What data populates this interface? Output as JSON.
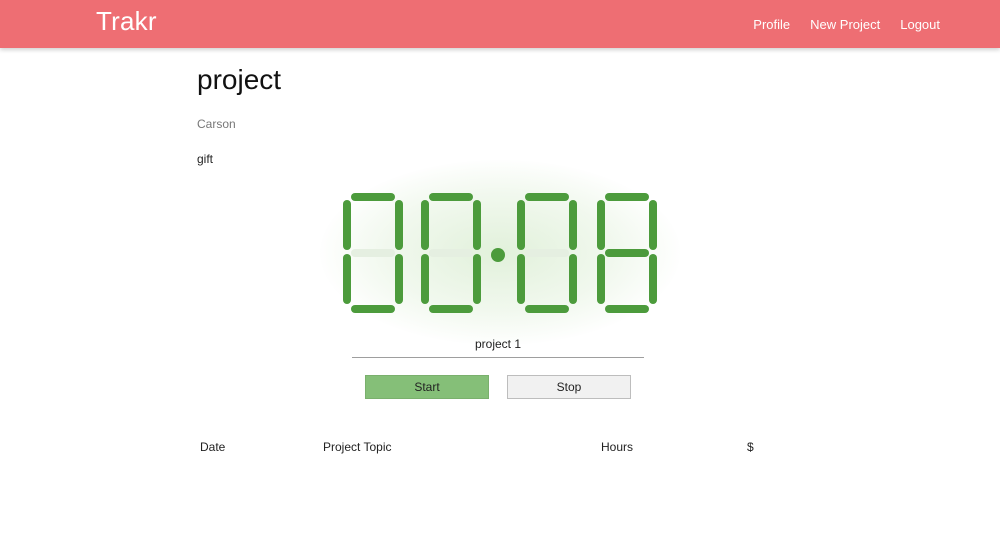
{
  "navbar": {
    "brand": "Trakr",
    "links": [
      "Profile",
      "New Project",
      "Logout"
    ]
  },
  "project": {
    "title": "project",
    "owner": "Carson",
    "description": "gift"
  },
  "timer": {
    "display": "00:08",
    "project_label": "project 1",
    "segment_on_color": "#4c9b3c",
    "segment_off_color": "#e5efe1"
  },
  "buttons": {
    "start": "Start",
    "stop": "Stop"
  },
  "table": {
    "headers": [
      "Date",
      "Project Topic",
      "Hours",
      "$"
    ]
  },
  "colors": {
    "navbar": "#ee6e73",
    "start_button": "#85bf78"
  }
}
